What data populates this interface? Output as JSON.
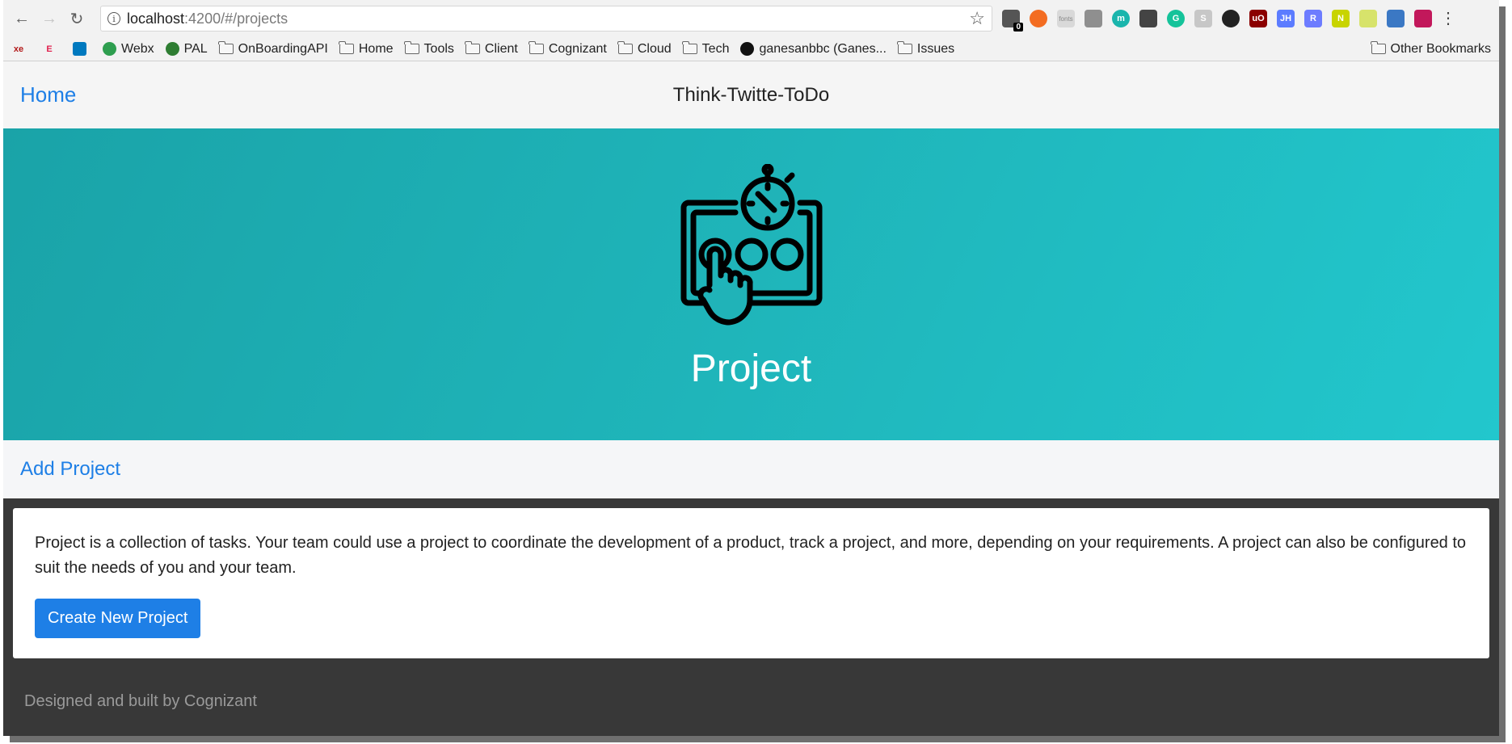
{
  "browser": {
    "url_host": "localhost",
    "url_path": ":4200/#/projects",
    "extensions_badge": "0",
    "extensions": [
      {
        "name": "toolbox-icon",
        "color": "#555555",
        "label": ""
      },
      {
        "name": "orange-ext-icon",
        "color": "#f36c21",
        "label": ""
      },
      {
        "name": "fonts-ext-icon",
        "color": "#d9d9d9",
        "label": "fonts"
      },
      {
        "name": "gray-ext-icon",
        "color": "#8f8f8f",
        "label": ""
      },
      {
        "name": "teal-ext-icon",
        "color": "#1ab5ac",
        "label": "m"
      },
      {
        "name": "screenshot-ext-icon",
        "color": "#444444",
        "label": ""
      },
      {
        "name": "grammarly-icon",
        "color": "#15c39a",
        "label": "G"
      },
      {
        "name": "skype-ext-icon",
        "color": "#c7c7c7",
        "label": "S"
      },
      {
        "name": "eye-ext-icon",
        "color": "#222222",
        "label": ""
      },
      {
        "name": "ublock-icon",
        "color": "#8b0000",
        "label": "uO"
      },
      {
        "name": "jh-ext-icon",
        "color": "#5c7cff",
        "label": "JH"
      },
      {
        "name": "r-ext-icon",
        "color": "#6d7cff",
        "label": "R"
      },
      {
        "name": "n-ext-icon",
        "color": "#c8d400",
        "label": "N"
      },
      {
        "name": "note-ext-icon",
        "color": "#d7e36b",
        "label": ""
      },
      {
        "name": "download-ext-icon",
        "color": "#3b78c4",
        "label": ""
      },
      {
        "name": "pink-ext-icon",
        "color": "#c2185b",
        "label": ""
      }
    ]
  },
  "bookmarks": {
    "items": [
      {
        "label": "",
        "icon": "xe-icon",
        "text": "xe",
        "color": "#b31b1b",
        "type": "site"
      },
      {
        "label": "",
        "icon": "editor-icon",
        "text": "E",
        "color": "#e0224f",
        "type": "site"
      },
      {
        "label": "",
        "icon": "trello-icon",
        "text": "",
        "color": "#0079bf",
        "type": "site"
      },
      {
        "label": "Webx",
        "icon": "webx-icon",
        "text": "",
        "color": "#2e9e4f",
        "type": "site"
      },
      {
        "label": "PAL",
        "icon": "globe-icon",
        "text": "",
        "color": "#2e7d32",
        "type": "site"
      },
      {
        "label": "OnBoardingAPI",
        "type": "folder"
      },
      {
        "label": "Home",
        "type": "folder"
      },
      {
        "label": "Tools",
        "type": "folder"
      },
      {
        "label": "Client",
        "type": "folder"
      },
      {
        "label": "Cognizant",
        "type": "folder"
      },
      {
        "label": "Cloud",
        "type": "folder"
      },
      {
        "label": "Tech",
        "type": "folder"
      },
      {
        "label": "ganesanbbc (Ganes...",
        "icon": "github-icon",
        "text": "",
        "color": "#111111",
        "type": "site"
      },
      {
        "label": "Issues",
        "type": "folder"
      }
    ],
    "other": "Other Bookmarks"
  },
  "navbar": {
    "home": "Home",
    "brand": "Think-Twitte-ToDo"
  },
  "hero": {
    "title": "Project"
  },
  "actions": {
    "add_project": "Add Project"
  },
  "card": {
    "description": "Project is a collection of tasks. Your team could use a project to coordinate the development of a product, track a project, and more, depending on your requirements. A project can also be configured to suit the needs of you and your team.",
    "create_button": "Create New Project"
  },
  "footer": {
    "text": "Designed and built by Cognizant"
  }
}
